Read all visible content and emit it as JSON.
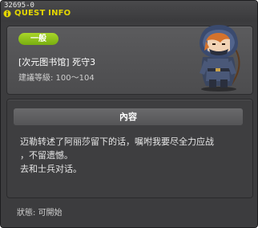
{
  "window": {
    "quest_id": "32695-0",
    "title": "QUEST INFO"
  },
  "quest": {
    "category_badge": "一般",
    "name": "[次元图书馆] 死守3",
    "level_text": "建議等級: 100～104"
  },
  "content": {
    "header": "內容",
    "description": "迈勒转述了阿丽莎留下的话，嘱咐我要尽全力应战\n，不留遗憾。\n去和士兵对话。"
  },
  "status": {
    "text": "狀態: 可開始"
  },
  "colors": {
    "title": "#e4d600",
    "badge": "#8fc21a",
    "window_bg": "#3c3c3e"
  },
  "icons": [
    "info-icon",
    "npc-portrait"
  ]
}
